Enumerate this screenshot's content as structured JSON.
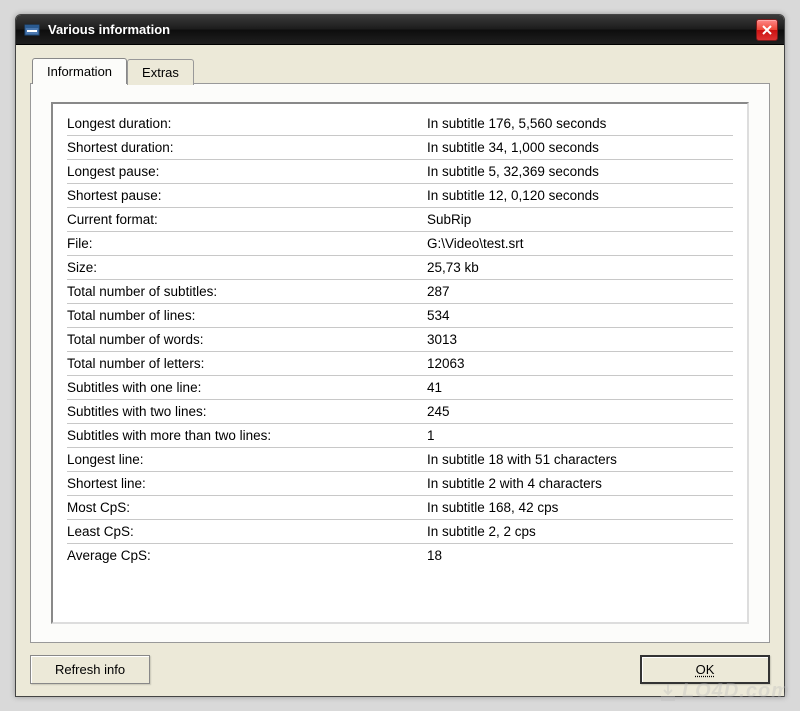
{
  "window": {
    "title": "Various information"
  },
  "tabs": {
    "information": "Information",
    "extras": "Extras"
  },
  "info": {
    "rows": [
      {
        "label": "Longest duration:",
        "value": "In subtitle 176, 5,560 seconds"
      },
      {
        "label": "Shortest duration:",
        "value": "In subtitle 34, 1,000 seconds"
      },
      {
        "label": "Longest pause:",
        "value": "In subtitle 5, 32,369 seconds"
      },
      {
        "label": "Shortest pause:",
        "value": "In subtitle 12, 0,120 seconds"
      },
      {
        "label": "Current format:",
        "value": "SubRip"
      },
      {
        "label": "File:",
        "value": "G:\\Video\\test.srt"
      },
      {
        "label": "Size:",
        "value": "25,73 kb"
      },
      {
        "label": "Total number of subtitles:",
        "value": "287"
      },
      {
        "label": "Total number of lines:",
        "value": "534"
      },
      {
        "label": "Total number of words:",
        "value": "3013"
      },
      {
        "label": "Total number of letters:",
        "value": "12063"
      },
      {
        "label": "Subtitles with one line:",
        "value": "41"
      },
      {
        "label": "Subtitles with two lines:",
        "value": "245"
      },
      {
        "label": "Subtitles with more than two lines:",
        "value": "1"
      },
      {
        "label": "Longest line:",
        "value": "In subtitle 18 with 51 characters"
      },
      {
        "label": "Shortest line:",
        "value": "In subtitle 2 with 4 characters"
      },
      {
        "label": "Most CpS:",
        "value": "In subtitle 168, 42 cps"
      },
      {
        "label": "Least CpS:",
        "value": "In subtitle 2, 2 cps"
      },
      {
        "label": "Average CpS:",
        "value": "18"
      }
    ]
  },
  "buttons": {
    "refresh": "Refresh info",
    "ok": "OK"
  },
  "watermark": "LO4D.com"
}
